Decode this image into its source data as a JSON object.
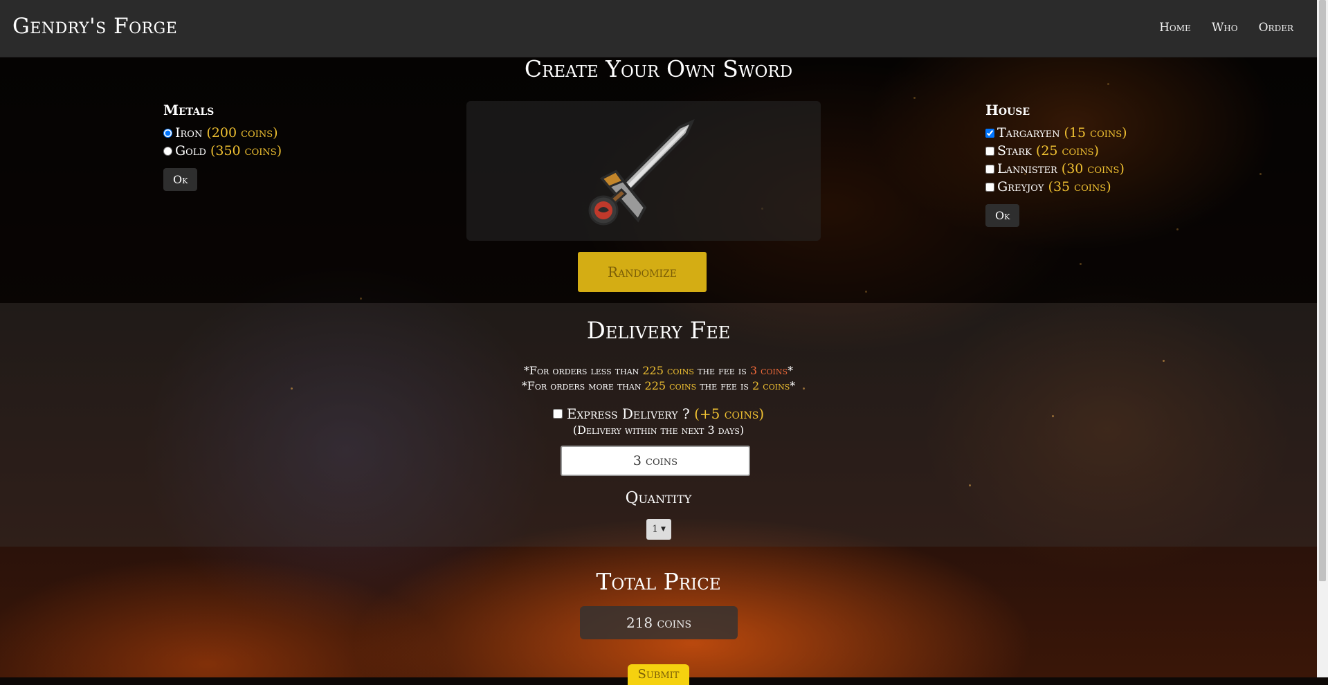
{
  "navbar": {
    "brand": "Gendry's Forge",
    "links": [
      "Home",
      "Who",
      "Order"
    ]
  },
  "create": {
    "title": "Create Your Own Sword"
  },
  "metals": {
    "heading": "Metals",
    "options": [
      {
        "label": "Iron",
        "price": "(200 coins)",
        "selected": true
      },
      {
        "label": "Gold",
        "price": "(350 coins)",
        "selected": false
      }
    ],
    "ok_label": "Ok"
  },
  "house": {
    "heading": "House",
    "options": [
      {
        "label": "Targaryen",
        "price": "(15 coins)",
        "checked": true
      },
      {
        "label": "Stark",
        "price": "(25 coins)",
        "checked": false
      },
      {
        "label": "Lannister",
        "price": "(30 coins)",
        "checked": false
      },
      {
        "label": "Greyjoy",
        "price": "(35 coins)",
        "checked": false
      }
    ],
    "ok_label": "Ok"
  },
  "randomize_label": "Randomize",
  "delivery": {
    "title": "Delivery Fee",
    "note1_prefix": "*For orders less than",
    "note1_amount": "225 coins",
    "note1_mid": "the fee is",
    "note1_fee": "3 coins",
    "note1_suffix": "*",
    "note2_prefix": "*For orders more than",
    "note2_amount": "225 coins",
    "note2_mid": "the fee is",
    "note2_fee": "2 coins",
    "note2_suffix": "*",
    "express_label": "Express Delivery ?",
    "express_extra": "(+5 coins)",
    "express_sub": "(Delivery within the next 3 days)",
    "express_checked": false,
    "fee_value": "3 coins"
  },
  "quantity": {
    "title": "Quantity",
    "selected": "1"
  },
  "total": {
    "title": "Total Price",
    "value": "218 coins"
  },
  "submit_label": "Submit",
  "colors": {
    "accent_gold": "#f1c232",
    "randomize_bg": "#d4ad14",
    "submit_bg": "#f5d10f",
    "navbar_bg": "#2b2b2b"
  }
}
